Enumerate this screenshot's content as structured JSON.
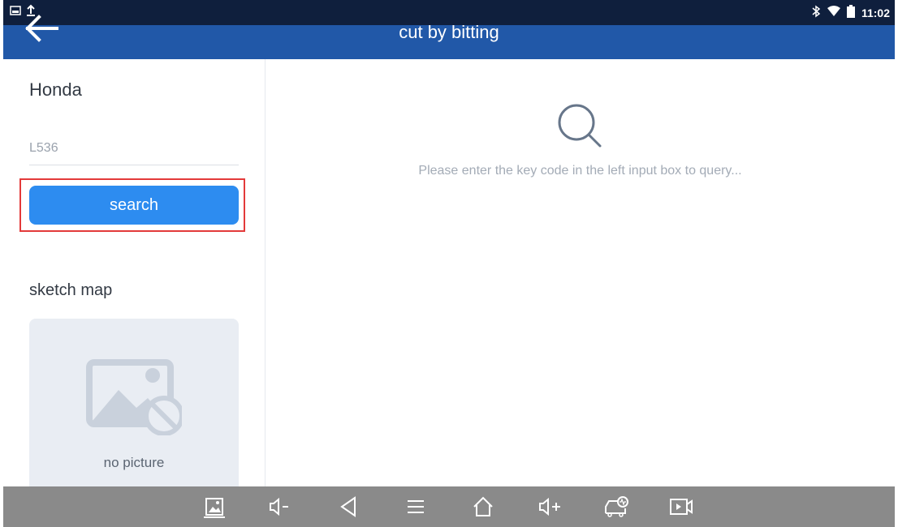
{
  "status_bar": {
    "time": "11:02",
    "icons": [
      "notification-icon",
      "upload-icon",
      "bluetooth-icon",
      "wifi-icon",
      "battery-icon"
    ]
  },
  "app_bar": {
    "title": "cut by bitting",
    "back_icon": "back-arrow-icon",
    "color": "#2158a8"
  },
  "left_panel": {
    "brand": "Honda",
    "key_code_input": {
      "value": "L536",
      "placeholder": ""
    },
    "search_button_label": "search",
    "search_button_color": "#2d8cf0",
    "highlight_color": "#e33a3a",
    "sketch_map_label": "sketch map",
    "no_picture_text": "no picture"
  },
  "right_panel": {
    "empty_icon": "search-icon",
    "empty_message": "Please enter the key code in the left input box to query..."
  },
  "nav_bar": {
    "buttons": [
      "screenshot-icon",
      "volume-down-icon",
      "back-icon",
      "menu-icon",
      "home-icon",
      "volume-up-icon",
      "vehicle-diagnostics-icon",
      "screen-record-icon"
    ]
  }
}
